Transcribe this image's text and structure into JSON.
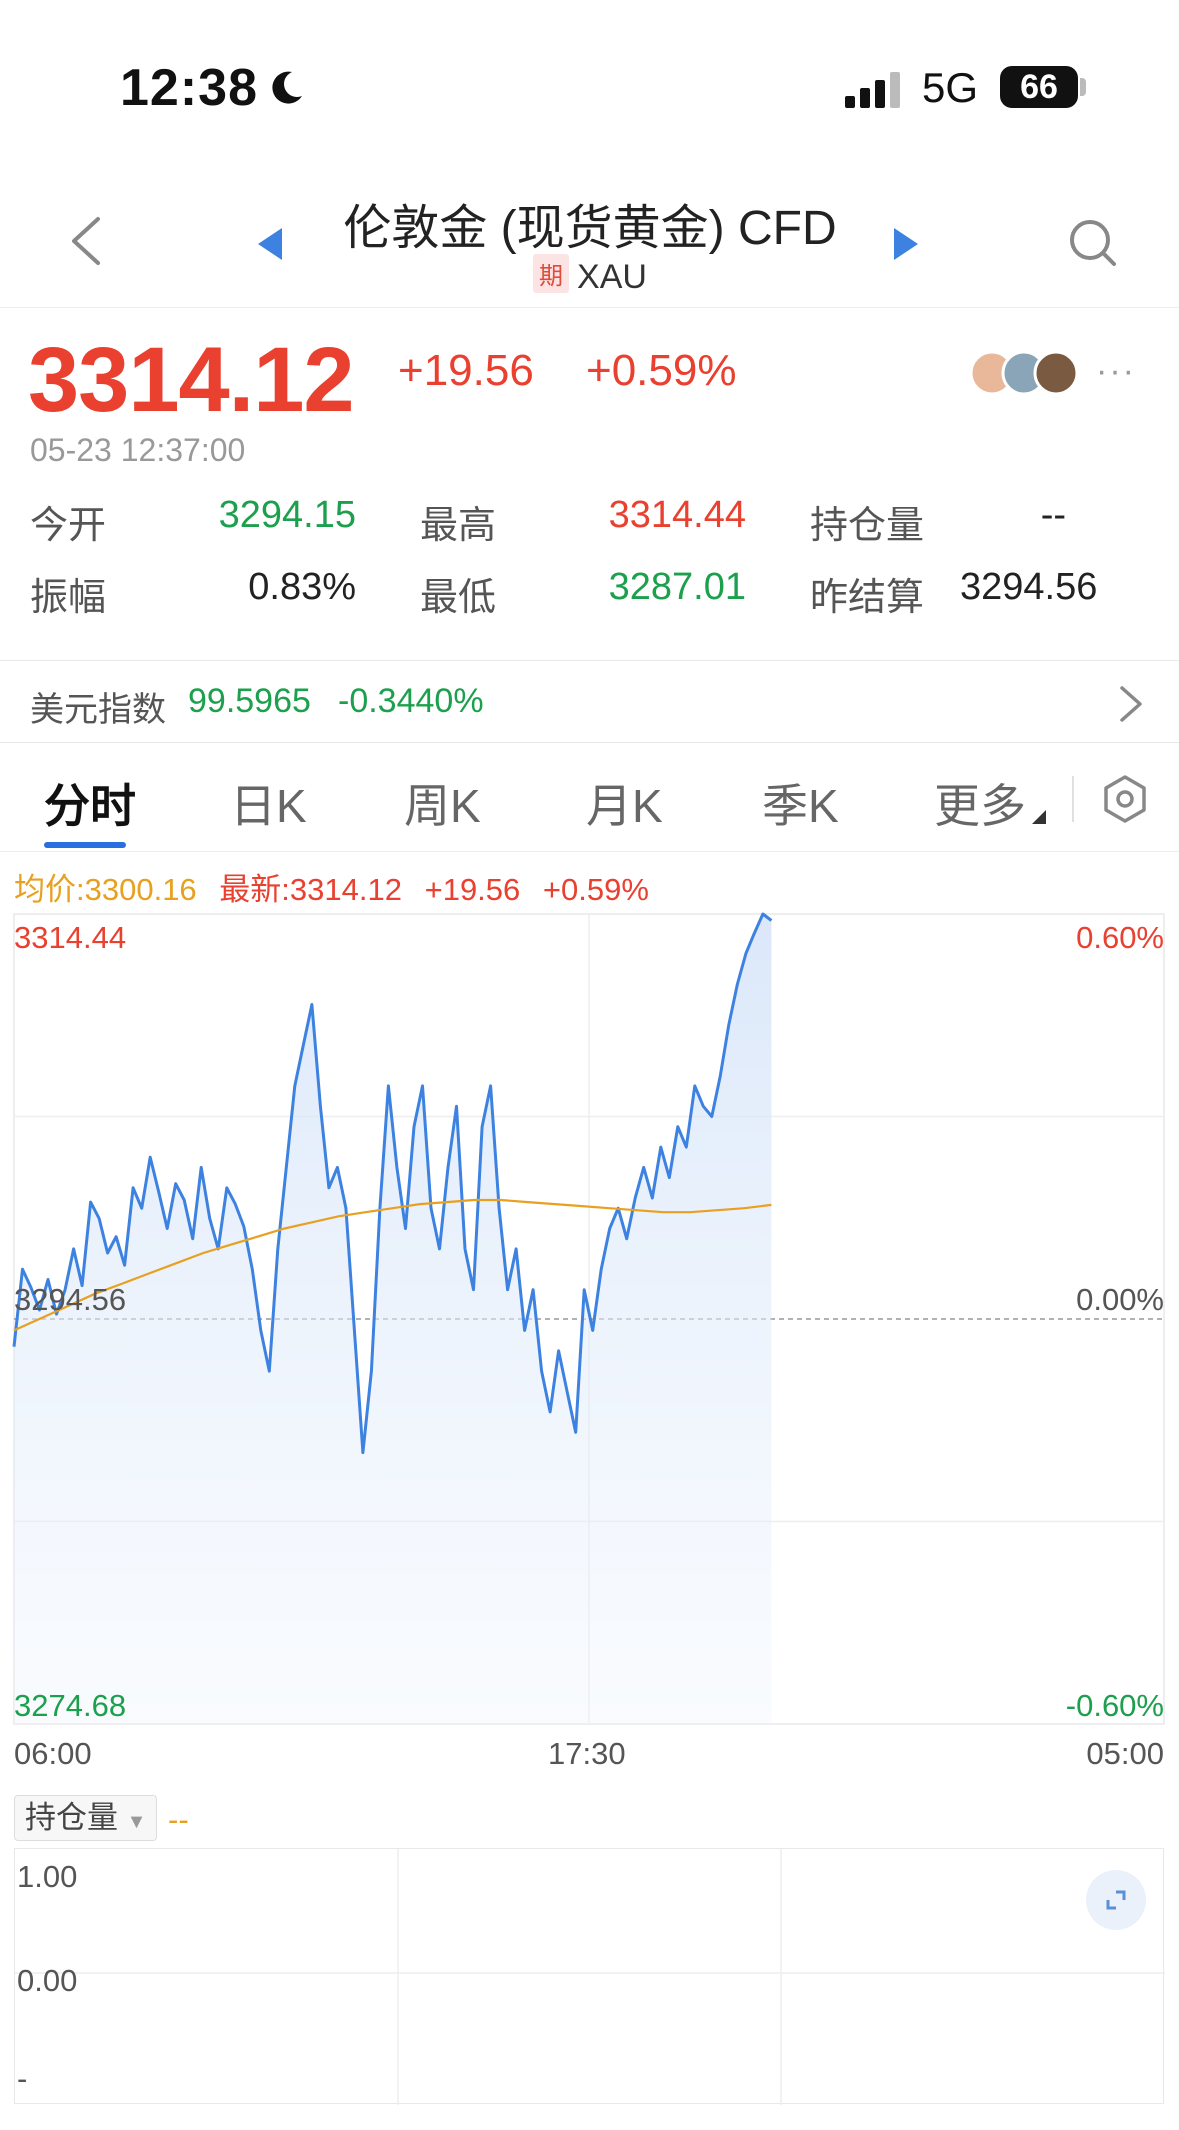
{
  "status_bar": {
    "time": "12:38",
    "network": "5G",
    "battery": "66"
  },
  "nav": {
    "title": "伦敦金 (现货黄金) CFD",
    "badge": "期",
    "symbol": "XAU"
  },
  "quote": {
    "price": "3314.12",
    "change": "+19.56",
    "change_pct": "+0.59%",
    "timestamp": "05-23 12:37:00",
    "more": "···",
    "stats": {
      "open_label": "今开",
      "open": "3294.15",
      "high_label": "最高",
      "high": "3314.44",
      "oi_label": "持仓量",
      "oi": "--",
      "amp_label": "振幅",
      "amp": "0.83%",
      "low_label": "最低",
      "low": "3287.01",
      "prev_label": "昨结算",
      "prev": "3294.56"
    }
  },
  "index_bar": {
    "label": "美元指数",
    "value": "99.5965",
    "change": "-0.3440%"
  },
  "tabs": [
    "分时",
    "日K",
    "周K",
    "月K",
    "季K",
    "更多"
  ],
  "info_line": {
    "avg": "均价:3300.16",
    "latest": "最新:3314.12",
    "chg": "+19.56",
    "pct": "+0.59%"
  },
  "chart_data": {
    "type": "line",
    "y_labels_left": [
      "3314.44",
      "3294.56",
      "3274.68"
    ],
    "y_labels_right": [
      "0.60%",
      "0.00%",
      "-0.60%"
    ],
    "x_labels": [
      "06:00",
      "17:30",
      "05:00"
    ],
    "ylim": [
      3274.68,
      3314.44
    ],
    "reference": 3294.56,
    "colors": {
      "price": "#3d82e0",
      "avg": "#e8a020",
      "up": "#e9402f",
      "down": "#1ca04d"
    },
    "series": [
      {
        "name": "最新",
        "values": [
          3293.2,
          3297.0,
          3296.1,
          3295.0,
          3296.5,
          3294.8,
          3296.0,
          3298.0,
          3296.2,
          3300.3,
          3299.5,
          3297.8,
          3298.6,
          3297.2,
          3301.0,
          3300.0,
          3302.5,
          3300.8,
          3299.0,
          3301.2,
          3300.4,
          3298.5,
          3302.0,
          3299.5,
          3298.0,
          3301.0,
          3300.2,
          3299.1,
          3297.0,
          3294.0,
          3292.0,
          3298.0,
          3302.0,
          3306.0,
          3308.0,
          3310.0,
          3305.0,
          3301.0,
          3302.0,
          3300.0,
          3294.0,
          3288.0,
          3292.0,
          3300.0,
          3306.0,
          3302.0,
          3299.0,
          3304.0,
          3306.0,
          3300.0,
          3298.0,
          3302.0,
          3305.0,
          3298.0,
          3296.0,
          3304.0,
          3306.0,
          3300.0,
          3296.0,
          3298.0,
          3294.0,
          3296.0,
          3292.0,
          3290.0,
          3293.0,
          3291.0,
          3289.0,
          3296.0,
          3294.0,
          3297.0,
          3299.0,
          3300.0,
          3298.5,
          3300.5,
          3302.0,
          3300.5,
          3303.0,
          3301.5,
          3304.0,
          3303.0,
          3306.0,
          3305.0,
          3304.5,
          3306.5,
          3309.0,
          3311.0,
          3312.5,
          3313.5,
          3314.44,
          3314.12
        ]
      },
      {
        "name": "均价",
        "values": [
          3294.0,
          3294.6,
          3295.2,
          3295.8,
          3296.3,
          3296.8,
          3297.3,
          3297.8,
          3298.2,
          3298.6,
          3299.0,
          3299.3,
          3299.6,
          3299.8,
          3300.0,
          3300.2,
          3300.3,
          3300.4,
          3300.4,
          3300.3,
          3300.2,
          3300.1,
          3300.0,
          3299.9,
          3299.8,
          3299.8,
          3299.9,
          3300.0,
          3300.16
        ]
      }
    ]
  },
  "open_interest": {
    "label": "持仓量",
    "value": "--",
    "y_labels": [
      "1.00",
      "0.00",
      "-"
    ]
  }
}
